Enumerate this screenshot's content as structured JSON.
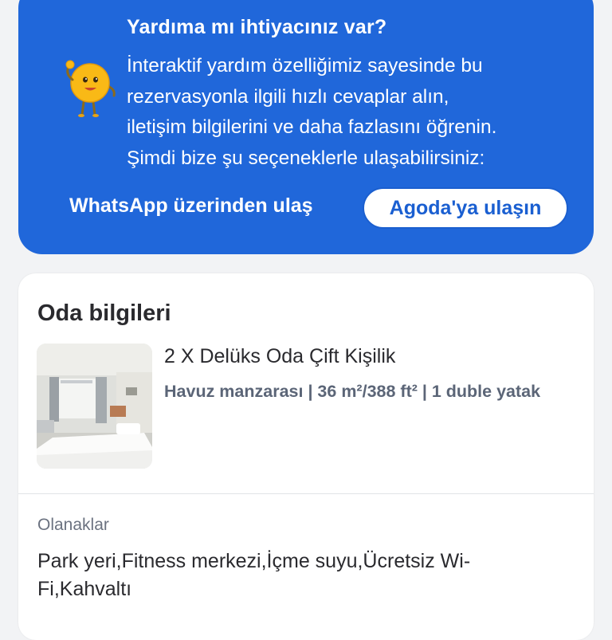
{
  "help": {
    "title": "Yardıma mı ihtiyacınız var?",
    "desc_lines": [
      "İnteraktif yardım özelliğimiz sayesinde bu",
      "rezervasyonla ilgili hızlı cevaplar alın,",
      "iletişim bilgilerini ve daha fazlasını öğrenin.",
      "Şimdi bize şu seçeneklerle ulaşabilirsiniz:"
    ],
    "whatsapp_label": "WhatsApp üzerinden ulaş",
    "agoda_label": "Agoda'ya ulaşın",
    "mascot_icon": "support-mascot-icon",
    "colors": {
      "card_bg": "#2067da",
      "text": "#ffffff",
      "button_text": "#1a5fd1"
    }
  },
  "room": {
    "section_title": "Oda bilgileri",
    "name": "2 X Delüks Oda Çift Kişilik",
    "details": "Havuz manzarası | 36 m²/388 ft² | 1 duble yatak",
    "amenities_label": "Olanaklar",
    "amenities_lines": [
      "Park yeri,Fitness merkezi,İçme suyu,Ücretsiz Wi-",
      "Fi,Kahvaltı"
    ]
  }
}
